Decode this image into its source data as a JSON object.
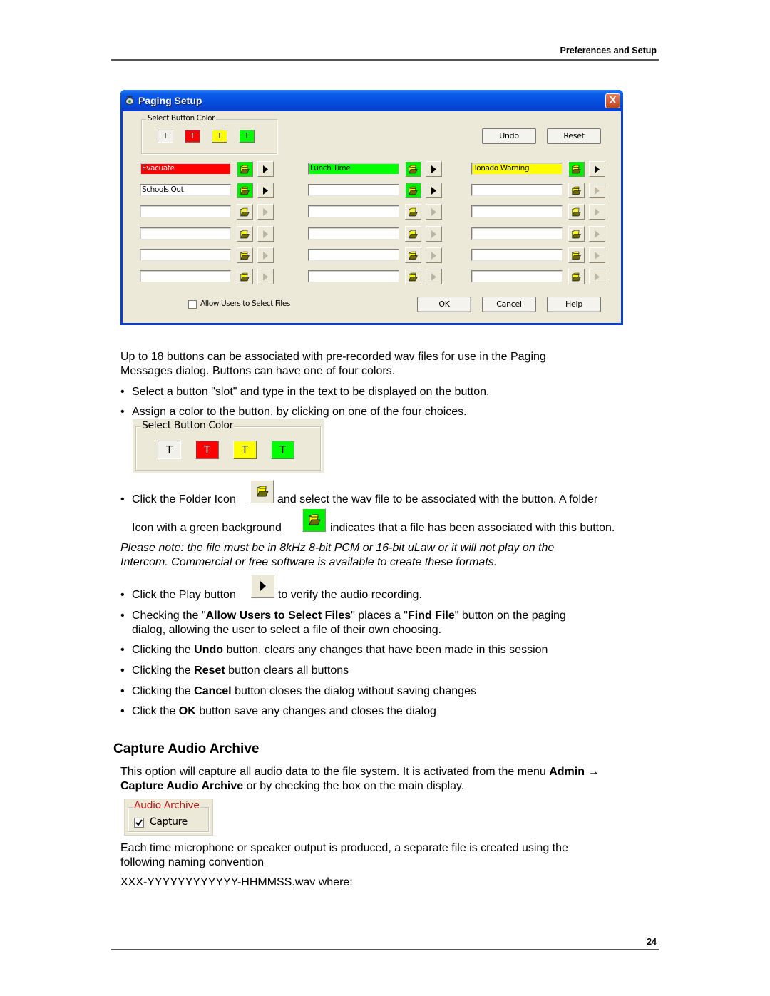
{
  "header": {
    "section_title": "Preferences and Setup"
  },
  "footer": {
    "page_number": "24"
  },
  "dialog": {
    "title": "Paging Setup",
    "close_glyph": "X",
    "color_group": {
      "label": "Select Button Color",
      "buttons": [
        {
          "label": "T",
          "color": "#f2f0ea",
          "text_color": "#000000",
          "selected": true
        },
        {
          "label": "T",
          "color": "#ff0000",
          "text_color": "#ffffff",
          "selected": false
        },
        {
          "label": "T",
          "color": "#ffff00",
          "text_color": "#000000",
          "selected": false
        },
        {
          "label": "T",
          "color": "#00ff00",
          "text_color": "#000000",
          "selected": false
        }
      ]
    },
    "undo_label": "Undo",
    "reset_label": "Reset",
    "ok_label": "OK",
    "cancel_label": "Cancel",
    "help_label": "Help",
    "allow_users_label": "Allow Users to Select Files",
    "allow_users_checked": false,
    "columns": [
      {
        "slots": [
          {
            "text": "Evacuate",
            "bg": "#ff0000",
            "fg": "#ffffff",
            "file_assigned": true
          },
          {
            "text": "Schools Out",
            "bg": "#ffffff",
            "fg": "#000000",
            "file_assigned": true
          },
          {
            "text": "",
            "bg": "#ffffff",
            "fg": "#000000",
            "file_assigned": false
          },
          {
            "text": "",
            "bg": "#ffffff",
            "fg": "#000000",
            "file_assigned": false
          },
          {
            "text": "",
            "bg": "#ffffff",
            "fg": "#000000",
            "file_assigned": false
          },
          {
            "text": "",
            "bg": "#ffffff",
            "fg": "#000000",
            "file_assigned": false
          }
        ]
      },
      {
        "slots": [
          {
            "text": "Lunch Time",
            "bg": "#00ff00",
            "fg": "#000000",
            "file_assigned": true
          },
          {
            "text": "",
            "bg": "#ffffff",
            "fg": "#000000",
            "file_assigned": true
          },
          {
            "text": "",
            "bg": "#ffffff",
            "fg": "#000000",
            "file_assigned": false
          },
          {
            "text": "",
            "bg": "#ffffff",
            "fg": "#000000",
            "file_assigned": false
          },
          {
            "text": "",
            "bg": "#ffffff",
            "fg": "#000000",
            "file_assigned": false
          },
          {
            "text": "",
            "bg": "#ffffff",
            "fg": "#000000",
            "file_assigned": false
          }
        ]
      },
      {
        "slots": [
          {
            "text": "Tonado Warning",
            "bg": "#ffff00",
            "fg": "#000000",
            "file_assigned": true
          },
          {
            "text": "",
            "bg": "#ffffff",
            "fg": "#000000",
            "file_assigned": false
          },
          {
            "text": "",
            "bg": "#ffffff",
            "fg": "#000000",
            "file_assigned": false
          },
          {
            "text": "",
            "bg": "#ffffff",
            "fg": "#000000",
            "file_assigned": false
          },
          {
            "text": "",
            "bg": "#ffffff",
            "fg": "#000000",
            "file_assigned": false
          },
          {
            "text": "",
            "bg": "#ffffff",
            "fg": "#000000",
            "file_assigned": false
          }
        ]
      }
    ],
    "icons": {
      "folder": "folder-icon",
      "play": "play-icon",
      "app": "speaker-icon"
    }
  },
  "content": {
    "intro_line1": "Up to 18 buttons can be associated with pre-recorded wav files for use in the Paging",
    "intro_line2": "Messages dialog.  Buttons can have one of four colors.",
    "bullet_slot": "Select a button \"slot\" and type in the text to be displayed on the button.",
    "bullet_color": "Assign a color to the button, by clicking on one of the four choices.",
    "bullet_folder_a": "Click the Folder Icon",
    "bullet_folder_b": "and select the wav file to be associated with the button.  A folder",
    "bullet_folder_c": "Icon with a green background",
    "bullet_folder_d": "indicates that a file has been associated with this button.",
    "note_line1": "Please note: the file must be in 8kHz 8-bit PCM or 16-bit uLaw or it will not play on the",
    "note_line2": "Intercom.  Commercial or free software is available to create these formats.",
    "bullet_play_a": "Click the Play button",
    "bullet_play_b": "to verify the audio recording.",
    "bullet_allow": {
      "pre": "Checking the \"",
      "bold1": "Allow Users to Select Files",
      "mid": "\" places a \"",
      "bold2": "Find File",
      "post": "\" button on the paging",
      "line2": "dialog, allowing the user to select a file of their own choosing."
    },
    "bullet_undo": {
      "pre": "Clicking the ",
      "bold": "Undo",
      "post": " button, clears any changes that have been made in this session"
    },
    "bullet_reset": {
      "pre": "Clicking the ",
      "bold": "Reset",
      "post": " button clears all buttons"
    },
    "bullet_cancel": {
      "pre": "Clicking the ",
      "bold": "Cancel",
      "post": " button closes the dialog without saving changes"
    },
    "bullet_ok": {
      "pre": "Click the ",
      "bold": "OK",
      "post": " button save any changes and closes the dialog"
    },
    "bullet_glyph": "•",
    "section_heading": "Capture Audio Archive",
    "archive_para": {
      "pre": "This option will capture all audio data to the file system. It is activated from the menu ",
      "bold1": "Admin →",
      "bold2": "Capture Audio Archive",
      "post": " or by checking the box on the main display."
    },
    "archive_group": {
      "label": "Audio Archive",
      "checkbox_label": "Capture",
      "checked": true,
      "label_color": "#b01818"
    },
    "naming_line1": "Each time microphone or speaker output is produced, a separate file is created using the",
    "naming_line2": "following naming convention",
    "naming_pattern": "XXX-YYYYYYYYYYYY-HHMMSS.wav where:"
  }
}
